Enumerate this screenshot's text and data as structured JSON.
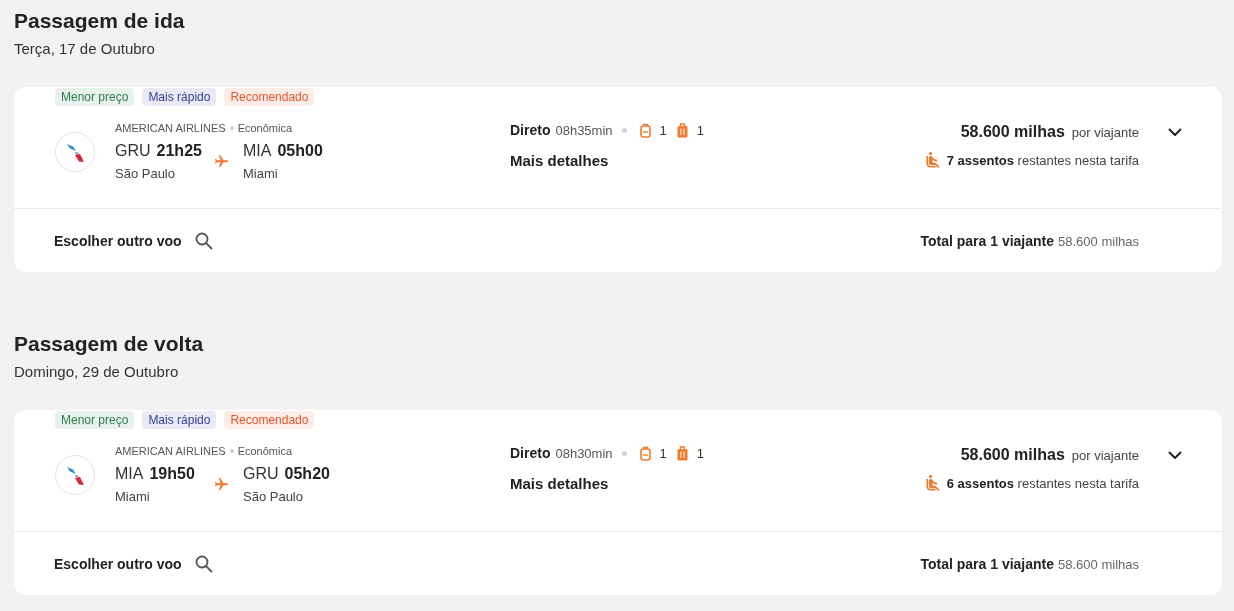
{
  "sections": [
    {
      "title": "Passagem de ida",
      "date": "Terça, 17 de Outubro",
      "flight": {
        "tags": [
          {
            "label": "Menor preço",
            "color": "#2e7d4f"
          },
          {
            "label": "Mais rápido",
            "color": "#34429a"
          },
          {
            "label": "Recomendado",
            "color": "#e4572e"
          }
        ],
        "airline": "AMERICAN AIRLINES",
        "cabin": "Econômica",
        "departure": {
          "code": "GRU",
          "time": "21h25",
          "city": "São Paulo"
        },
        "arrival": {
          "code": "MIA",
          "time": "05h00",
          "city": "Miami"
        },
        "stops": "Direto",
        "duration": "08h35min",
        "backpacks": "1",
        "suitcases": "1",
        "details_link": "Mais detalhes",
        "price": "58.600 milhas",
        "price_unit": "por viajante",
        "seats": "**7 assentos** restantes nesta tarifa",
        "expanded": false
      },
      "footer": {
        "change_button": "Escolher outro voo",
        "total_label": "Total para 1 viajante",
        "total_value": "58.600 milhas"
      }
    },
    {
      "title": "Passagem de volta",
      "date": "Domingo, 29 de Outubro",
      "flight": {
        "tags": [
          {
            "label": "Menor preço",
            "color": "#2e7d4f"
          },
          {
            "label": "Mais rápido",
            "color": "#34429a"
          },
          {
            "label": "Recomendado",
            "color": "#e4572e"
          }
        ],
        "airline": "AMERICAN AIRLINES",
        "cabin": "Econômica",
        "departure": {
          "code": "MIA",
          "time": "19h50",
          "city": "Miami"
        },
        "arrival": {
          "code": "GRU",
          "time": "05h20",
          "city": "São Paulo"
        },
        "stops": "Direto",
        "duration": "08h30min",
        "backpacks": "1",
        "suitcases": "1",
        "details_link": "Mais detalhes",
        "price": "58.600 milhas",
        "price_unit": "por viajante",
        "seats": "**6 assentos** restantes nesta tarifa",
        "expanded": false
      },
      "footer": {
        "change_button": "Escolher outro voo",
        "total_label": "Total para 1 viajante",
        "total_value": "58.600 milhas"
      }
    }
  ]
}
